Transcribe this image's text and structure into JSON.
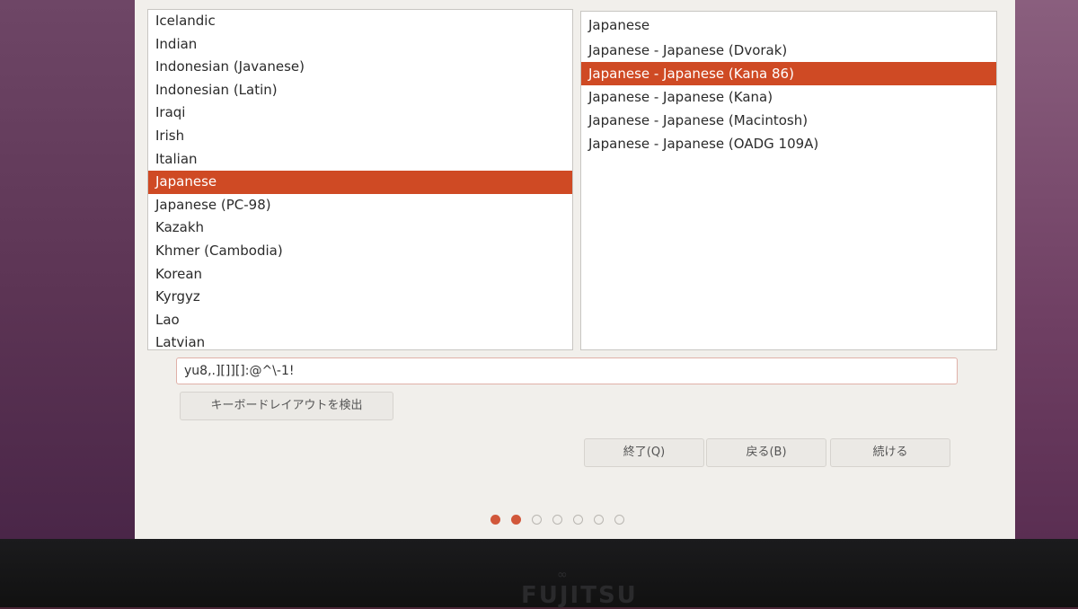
{
  "layouts": {
    "items": [
      {
        "label": "Icelandic"
      },
      {
        "label": "Indian"
      },
      {
        "label": "Indonesian (Javanese)"
      },
      {
        "label": "Indonesian (Latin)"
      },
      {
        "label": "Iraqi"
      },
      {
        "label": "Irish"
      },
      {
        "label": "Italian"
      },
      {
        "label": "Japanese"
      },
      {
        "label": "Japanese (PC-98)"
      },
      {
        "label": "Kazakh"
      },
      {
        "label": "Khmer (Cambodia)"
      },
      {
        "label": "Korean"
      },
      {
        "label": "Kyrgyz"
      },
      {
        "label": "Lao"
      },
      {
        "label": "Latvian"
      }
    ],
    "selected": "Japanese"
  },
  "variants": {
    "items": [
      {
        "label": "Japanese"
      },
      {
        "label": "Japanese - Japanese (Dvorak)"
      },
      {
        "label": "Japanese - Japanese (Kana 86)"
      },
      {
        "label": "Japanese - Japanese (Kana)"
      },
      {
        "label": "Japanese - Japanese (Macintosh)"
      },
      {
        "label": "Japanese - Japanese (OADG 109A)"
      }
    ],
    "selected": "Japanese - Japanese (Kana 86)"
  },
  "test_input": {
    "value": "yu8,.][]][]:@^\\-1!"
  },
  "detect_button": {
    "label": "キーボードレイアウトを検出"
  },
  "nav": {
    "quit_label": "終了(Q)",
    "back_label": "戻る(B)",
    "continue_label": "続ける"
  },
  "progress": {
    "total_steps": 7,
    "completed_steps": 2
  },
  "colors": {
    "accent": "#cf4a24",
    "window_bg": "#f1efeb",
    "list_bg": "#ffffff"
  },
  "bezel": {
    "brand": "FUJITSU"
  }
}
